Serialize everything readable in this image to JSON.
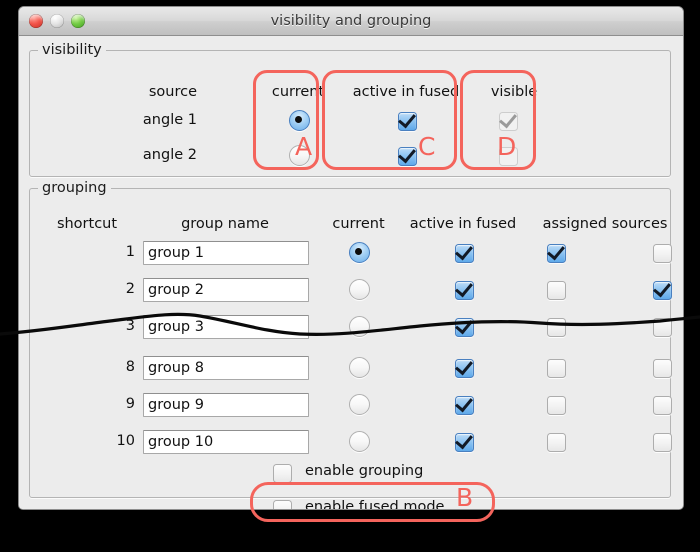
{
  "window": {
    "title": "visibility and grouping",
    "traffic_lights": [
      {
        "name": "close-button",
        "color": "#f2544a"
      },
      {
        "name": "minimize-button",
        "color": "#e4e4e4"
      },
      {
        "name": "zoom-button",
        "color": "#74cc45"
      }
    ]
  },
  "visibility": {
    "legend": "visibility",
    "headers": {
      "source": "source",
      "current": "current",
      "active_in_fused": "active in fused",
      "visible": "visible"
    },
    "rows": [
      {
        "source": "angle 1",
        "current": true,
        "active_in_fused": true,
        "visible": true,
        "visible_enabled": false
      },
      {
        "source": "angle 2",
        "current": false,
        "active_in_fused": true,
        "visible": false,
        "visible_enabled": false
      }
    ]
  },
  "grouping": {
    "legend": "grouping",
    "headers": {
      "shortcut": "shortcut",
      "group_name": "group name",
      "current": "current",
      "active_in_fused": "active in fused",
      "assigned_sources": "assigned sources"
    },
    "rows": [
      {
        "shortcut": "1",
        "name": "group 1",
        "current": true,
        "active_in_fused": true,
        "assigned": [
          true,
          false
        ]
      },
      {
        "shortcut": "2",
        "name": "group 2",
        "current": false,
        "active_in_fused": true,
        "assigned": [
          false,
          true
        ]
      },
      {
        "shortcut": "3",
        "name": "group 3",
        "current": false,
        "active_in_fused": true,
        "assigned": [
          false,
          false
        ]
      },
      {
        "shortcut": "8",
        "name": "group 8",
        "current": false,
        "active_in_fused": true,
        "assigned": [
          false,
          false
        ]
      },
      {
        "shortcut": "9",
        "name": "group 9",
        "current": false,
        "active_in_fused": true,
        "assigned": [
          false,
          false
        ]
      },
      {
        "shortcut": "10",
        "name": "group 10",
        "current": false,
        "active_in_fused": true,
        "assigned": [
          false,
          false
        ]
      }
    ],
    "options": [
      {
        "label": "enable grouping",
        "checked": false
      },
      {
        "label": "enable fused mode",
        "checked": false
      }
    ]
  },
  "annotations": {
    "color": "#f4645c",
    "items": [
      {
        "letter": "A",
        "target": "visibility-current-column"
      },
      {
        "letter": "B",
        "target": "enable-fused-mode-option"
      },
      {
        "letter": "C",
        "target": "visibility-active-in-fused-column"
      },
      {
        "letter": "D",
        "target": "visibility-visible-column"
      }
    ]
  }
}
